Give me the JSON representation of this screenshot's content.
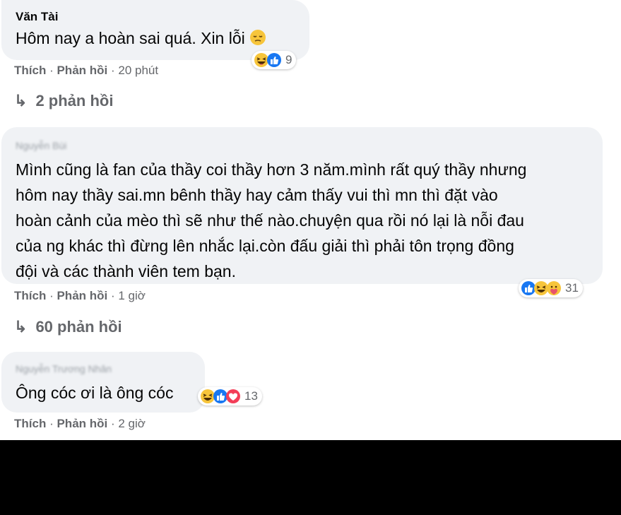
{
  "comments": [
    {
      "author": "Văn Tài",
      "text": "Hôm nay a hoàn sai quá. Xin lỗi",
      "reaction_count": "9",
      "like_label": "Thích",
      "reply_label": "Phản hồi",
      "time": "20 phút",
      "replies_label": "2 phản hồi"
    },
    {
      "author": "Nguyễn Bùi",
      "text_lines": [
        "Mình cũng là fan của thầy coi thầy hơn 3 năm.mình rất quý thầy nhưng",
        "hôm nay thầy sai.mn bênh thầy hay cảm thấy vui thì mn thì đặt vào",
        "hoàn cảnh của mèo thì sẽ như thế nào.chuyện qua rồi nó lại là nỗi đau",
        "của ng khác thì đừng lên nhắc lại.còn đấu giải thì phải tôn trọng đồng",
        "đội và các thành viên tem bạn."
      ],
      "reaction_count": "31",
      "like_label": "Thích",
      "reply_label": "Phản hồi",
      "time": "1 giờ",
      "replies_label": "60 phản hồi"
    },
    {
      "author": "Nguyễn Trương Nhân",
      "text": "Ông cóc ơi là ông cóc",
      "reaction_count": "13",
      "like_label": "Thích",
      "reply_label": "Phản hồi",
      "time": "2 giờ"
    }
  ],
  "icons": [
    "haha-icon",
    "like-icon",
    "sad-icon",
    "love-icon",
    "care-icon",
    "reply-arrow-icon"
  ]
}
